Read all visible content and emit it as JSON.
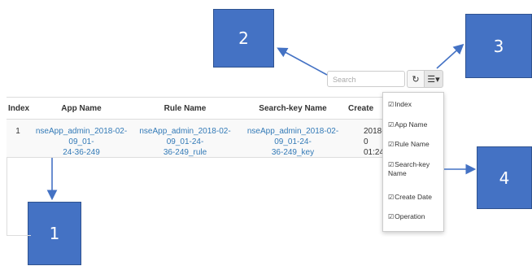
{
  "annotations": {
    "a1": "1",
    "a2": "2",
    "a3": "3",
    "a4": "4"
  },
  "toolbar": {
    "search_placeholder": "Search",
    "refresh_glyph": "↻",
    "columns_glyph": "☰▾"
  },
  "table": {
    "headers": [
      "Index",
      "App Name",
      "Rule Name",
      "Search-key Name",
      "Create"
    ],
    "row": {
      "index": "1",
      "app_name_l1": "nseApp_admin_2018-02-09_01-",
      "app_name_l2": "24-36-249",
      "rule_name_l1": "nseApp_admin_2018-02-09_01-24-",
      "rule_name_l2": "36-249_rule",
      "search_key_l1": "nseApp_admin_2018-02-09_01-24-",
      "search_key_l2": "36-249_key",
      "create_l1": "2018-0",
      "create_l2": "01:24:"
    }
  },
  "column_menu": {
    "check_glyph": "☑",
    "items": [
      "Index",
      "App Name",
      "Rule Name",
      "Search-key",
      "Name",
      "Create Date",
      "Operation"
    ]
  },
  "colors": {
    "callout": "#4472c4",
    "link": "#337ab7"
  }
}
